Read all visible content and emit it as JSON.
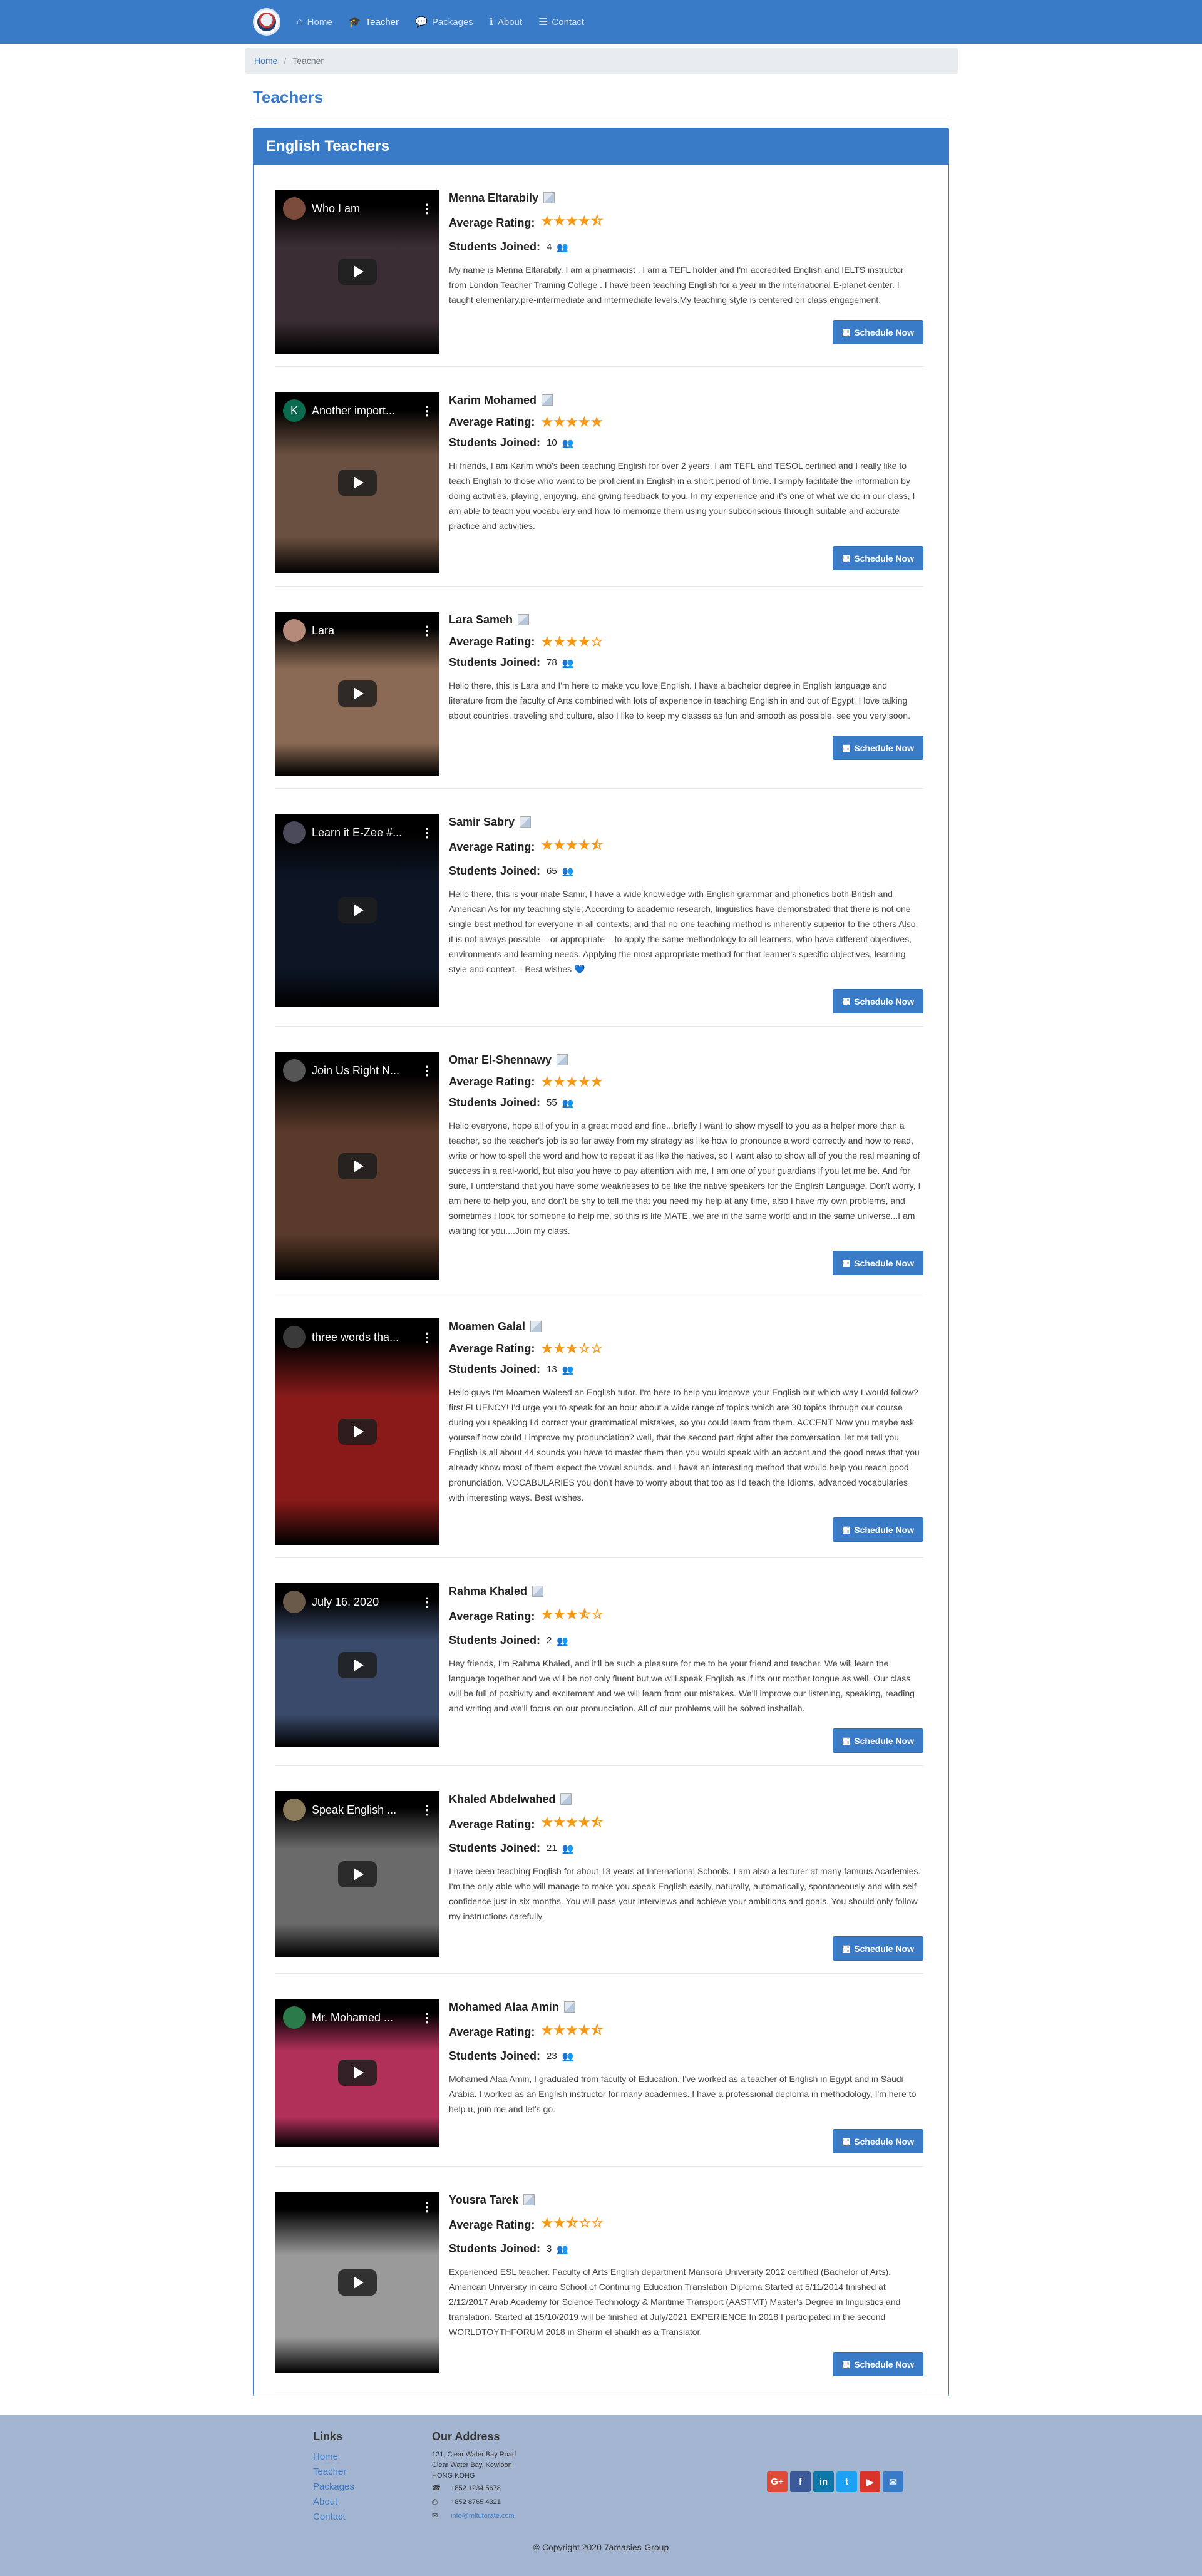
{
  "nav": {
    "items": [
      {
        "label": "Home",
        "icon": "home-icon"
      },
      {
        "label": "Teacher",
        "icon": "graduation-cap-icon"
      },
      {
        "label": "Packages",
        "icon": "comment-icon"
      },
      {
        "label": "About",
        "icon": "info-icon"
      },
      {
        "label": "Contact",
        "icon": "list-icon"
      }
    ],
    "active": "Teacher"
  },
  "breadcrumb": {
    "home": "Home",
    "current": "Teacher"
  },
  "page_title": "Teachers",
  "panel_title": "English Teachers",
  "labels": {
    "avg_rating": "Average Rating:",
    "students_joined": "Students Joined:",
    "schedule": "Schedule Now"
  },
  "teachers": [
    {
      "name": "Menna Eltarabily",
      "rating": 4.5,
      "students": "4",
      "video_title": "Who I am",
      "avatar_color": "#7a4a3a",
      "avatar_letter": "",
      "video_bg": "#3a2e34",
      "desc": "My name is Menna Eltarabily. I am a pharmacist . I am a TEFL holder and I'm accredited English and IELTS instructor from London Teacher Training College . I have been teaching English for a year in the international E-planet center. I taught elementary,pre-intermediate and intermediate levels.My teaching style is centered on class engagement."
    },
    {
      "name": "Karim Mohamed",
      "rating": 5,
      "students": "10",
      "video_title": "Another import...",
      "avatar_color": "#0b6b4f",
      "avatar_letter": "K",
      "video_bg": "#6a5040",
      "desc": "Hi friends, I am Karim who's been teaching English for over 2 years. I am TEFL and TESOL certified and I really like to teach English to those who want to be proficient in English in a short period of time. I simply facilitate the information by doing activities, playing, enjoying, and giving feedback to you. In my experience and it's one of what we do in our class, I am able to teach you vocabulary and how to memorize them using your subconscious through suitable and accurate practice and activities."
    },
    {
      "name": "Lara Sameh",
      "rating": 4,
      "students": "78",
      "video_title": "Lara",
      "avatar_color": "#b58a7a",
      "avatar_letter": "",
      "video_bg": "#8a6a55",
      "desc": "Hello there, this is Lara and I'm here to make you love English. I have a bachelor degree in English language and literature from the faculty of Arts combined with lots of experience in teaching English in and out of Egypt. I love talking about countries, traveling and culture, also I like to keep my classes as fun and smooth as possible, see you very soon."
    },
    {
      "name": "Samir Sabry",
      "rating": 4.5,
      "students": "65",
      "video_title": "Learn it E-Zee #...",
      "avatar_color": "#4a4a5a",
      "avatar_letter": "",
      "video_bg": "#0e1626",
      "desc": "Hello there, this is your mate Samir, I have a wide knowledge with English grammar and phonetics both British and American As for my teaching style; According to academic research, linguistics have demonstrated that there is not one single best method for everyone in all contexts, and that no one teaching method is inherently superior to the others Also, it is not always possible – or appropriate – to apply the same methodology to all learners, who have different objectives, environments and learning needs. Applying the most appropriate method for that learner's specific objectives, learning style and context. - Best wishes 💙"
    },
    {
      "name": "Omar El-Shennawy",
      "rating": 5,
      "students": "55",
      "video_title": "Join Us Right N...",
      "avatar_color": "#555555",
      "avatar_letter": "",
      "video_bg": "#5a3a2a",
      "desc": "Hello everyone, hope all of you in a great mood and fine...briefly I want to show myself to you as a helper more than a teacher, so the teacher's job is so far away from my strategy as like how to pronounce a word correctly and how to read, write or how to spell the word and how to repeat it as like the natives, so I want also to show all of you the real meaning of success in a real-world, but also you have to pay attention with me, I am one of your guardians if you let me be. And for sure, I understand that you have some weaknesses to be like the native speakers for the English Language, Don't worry, I am here to help you, and don't be shy to tell me that you need my help at any time, also I have my own problems, and sometimes I look for someone to help me, so this is life MATE, we are in the same world and in the same universe...I am waiting for you....Join my class."
    },
    {
      "name": "Moamen Galal",
      "rating": 3,
      "students": "13",
      "video_title": "three words tha...",
      "avatar_color": "#3a3a3a",
      "avatar_letter": "",
      "video_bg": "#8a1a1a",
      "desc": "Hello guys I'm Moamen Waleed an English tutor. I'm here to help you improve your English but which way I would follow? first FLUENCY! I'd urge you to speak for an hour about a wide range of topics which are 30 topics through our course during you speaking I'd correct your grammatical mistakes, so you could learn from them. ACCENT Now you maybe ask yourself how could I improve my pronunciation? well, that the second part right after the conversation. let me tell you English is all about 44 sounds you have to master them then you would speak with an accent and the good news that you already know most of them expect the vowel sounds. and I have an interesting method that would help you reach good pronunciation. VOCABULARIES you don't have to worry about that too as I'd teach the Idioms, advanced vocabularies with interesting ways. Best wishes."
    },
    {
      "name": "Rahma Khaled",
      "rating": 3.5,
      "students": "2",
      "video_title": "July 16, 2020",
      "avatar_color": "#6a5a4a",
      "avatar_letter": "",
      "video_bg": "#3a4a6a",
      "desc": "Hey friends, I'm Rahma Khaled, and it'll be such a pleasure for me to be your friend and teacher. We will learn the language together and we will be not only fluent but we will speak English as if it's our mother tongue as well. Our class will be full of positivity and excitement and we will learn from our mistakes. We'll improve our listening, speaking, reading and writing and we'll focus on our pronunciation. All of our problems will be solved inshallah."
    },
    {
      "name": "Khaled Abdelwahed",
      "rating": 4.5,
      "students": "21",
      "video_title": "Speak English ...",
      "avatar_color": "#8a7a5a",
      "avatar_letter": "",
      "video_bg": "#6a6a6a",
      "desc": "I have been teaching English for about 13 years at International Schools. I am also a lecturer at many famous Academies. I'm the only able who will manage to make you speak English easily, naturally, automatically, spontaneously and with self-confidence just in six months. You will pass your interviews and achieve your ambitions and goals. You should only follow my instructions carefully."
    },
    {
      "name": "Mohamed Alaa Amin",
      "rating": 4.5,
      "students": "23",
      "video_title": "Mr. Mohamed ...",
      "avatar_color": "#2a7a4a",
      "avatar_letter": "",
      "video_bg": "#b0305a",
      "desc": "Mohamed Alaa Amin, I graduated from faculty of Education. I've worked as a teacher of English in Egypt and in Saudi Arabia. I worked as an English instructor for many academies. I have a professional deploma in methodology, I'm here to help u, join me and let's go."
    },
    {
      "name": "Yousra Tarek",
      "rating": 2.5,
      "students": "3",
      "video_title": "",
      "avatar_color": "",
      "avatar_letter": "",
      "video_bg": "#9a9a9a",
      "desc": "Experienced ESL teacher. Faculty of Arts English department Mansora University 2012 certified (Bachelor of Arts). American University in cairo School of Continuing Education Translation Diploma Started at 5/11/2014 finished at 2/12/2017 Arab Academy for Science Technology & Maritime Transport (AASTMT) Master's Degree in linguistics and translation. Started at 15/10/2019 will be finished at July/2021 EXPERIENCE In 2018 I participated in the second WORLDTOYTHFORUM 2018 in Sharm el shaikh as a Translator."
    }
  ],
  "footer": {
    "links_title": "Links",
    "links": [
      "Home",
      "Teacher",
      "Packages",
      "About",
      "Contact"
    ],
    "address_title": "Our Address",
    "address_lines": [
      "121, Clear Water Bay Road",
      "Clear Water Bay, Kowloon",
      "HONG KONG"
    ],
    "phone": "+852 1234 5678",
    "fax": "+852 8765 4321",
    "email": "info@mltutorate.com",
    "social": [
      {
        "name": "google-plus-icon",
        "glyph": "G+",
        "color": "#dd4b39"
      },
      {
        "name": "facebook-icon",
        "glyph": "f",
        "color": "#3b5998"
      },
      {
        "name": "linkedin-icon",
        "glyph": "in",
        "color": "#0e76a8"
      },
      {
        "name": "twitter-icon",
        "glyph": "t",
        "color": "#1da1f2"
      },
      {
        "name": "youtube-icon",
        "glyph": "▶",
        "color": "#d9342b"
      },
      {
        "name": "mail-icon",
        "glyph": "✉",
        "color": "#3a7bc8"
      }
    ],
    "copyright": "© Copyright 2020 7amasies-Group"
  }
}
